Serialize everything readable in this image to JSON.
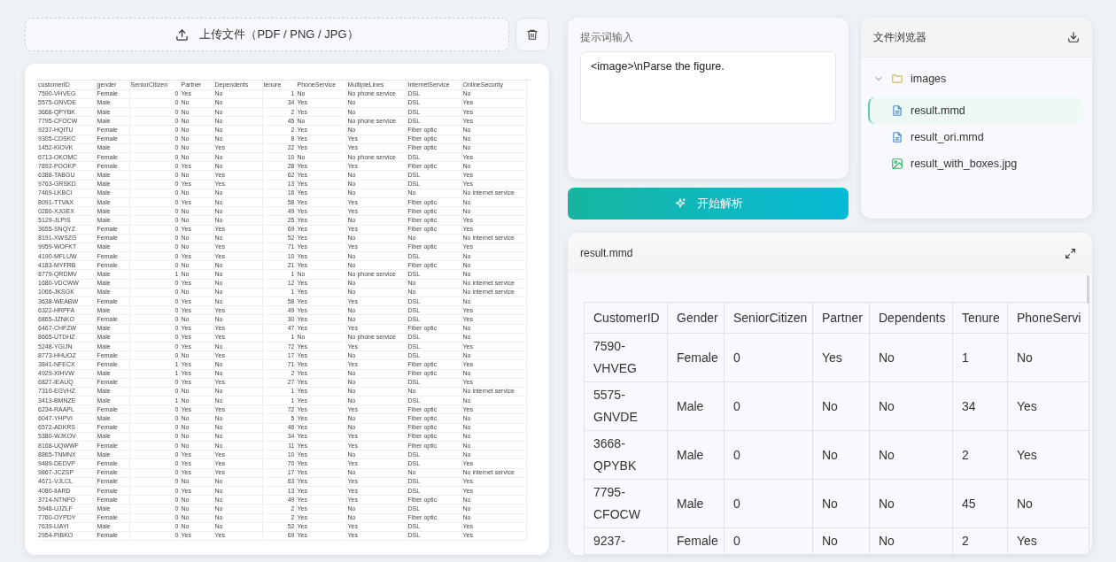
{
  "upload_button": {
    "label": "上传文件（PDF / PNG / JPG）"
  },
  "document_preview": {
    "columns": [
      "customerID",
      "gender",
      "SeniorCitizen",
      "Partner",
      "Dependents",
      "tenure",
      "PhoneService",
      "MultipleLines",
      "InternetService",
      "OnlineSecurity"
    ],
    "rows": [
      [
        "7590-VHVEG",
        "Female",
        "0",
        "Yes",
        "No",
        "1",
        "No",
        "No phone service",
        "DSL",
        "No"
      ],
      [
        "5575-GNVDE",
        "Male",
        "0",
        "No",
        "No",
        "34",
        "Yes",
        "No",
        "DSL",
        "Yes"
      ],
      [
        "3668-QPYBK",
        "Male",
        "0",
        "No",
        "No",
        "2",
        "Yes",
        "No",
        "DSL",
        "Yes"
      ],
      [
        "7795-CFOCW",
        "Male",
        "0",
        "No",
        "No",
        "45",
        "No",
        "No phone service",
        "DSL",
        "Yes"
      ],
      [
        "9237-HQITU",
        "Female",
        "0",
        "No",
        "No",
        "2",
        "Yes",
        "No",
        "Fiber optic",
        "No"
      ],
      [
        "9305-CDSKC",
        "Female",
        "0",
        "No",
        "No",
        "8",
        "Yes",
        "Yes",
        "Fiber optic",
        "No"
      ],
      [
        "1452-KIOVK",
        "Male",
        "0",
        "No",
        "Yes",
        "22",
        "Yes",
        "Yes",
        "Fiber optic",
        "No"
      ],
      [
        "6713-OKOMC",
        "Female",
        "0",
        "No",
        "No",
        "10",
        "No",
        "No phone service",
        "DSL",
        "Yes"
      ],
      [
        "7892-POOKP",
        "Female",
        "0",
        "Yes",
        "No",
        "28",
        "Yes",
        "Yes",
        "Fiber optic",
        "No"
      ],
      [
        "6388-TABGU",
        "Male",
        "0",
        "No",
        "Yes",
        "62",
        "Yes",
        "No",
        "DSL",
        "Yes"
      ],
      [
        "9763-GRSKD",
        "Male",
        "0",
        "Yes",
        "Yes",
        "13",
        "Yes",
        "No",
        "DSL",
        "Yes"
      ],
      [
        "7469-LKBCI",
        "Male",
        "0",
        "No",
        "No",
        "16",
        "Yes",
        "No",
        "No",
        "No internet service"
      ],
      [
        "8091-TTVAX",
        "Male",
        "0",
        "Yes",
        "No",
        "58",
        "Yes",
        "Yes",
        "Fiber optic",
        "No"
      ],
      [
        "0280-XJGEX",
        "Male",
        "0",
        "No",
        "No",
        "49",
        "Yes",
        "Yes",
        "Fiber optic",
        "No"
      ],
      [
        "5129-JLPIS",
        "Male",
        "0",
        "No",
        "No",
        "25",
        "Yes",
        "No",
        "Fiber optic",
        "Yes"
      ],
      [
        "3655-SNQYZ",
        "Female",
        "0",
        "Yes",
        "Yes",
        "69",
        "Yes",
        "Yes",
        "Fiber optic",
        "Yes"
      ],
      [
        "8191-XWSZG",
        "Female",
        "0",
        "No",
        "No",
        "52",
        "Yes",
        "No",
        "No",
        "No internet service"
      ],
      [
        "9959-WOFKT",
        "Male",
        "0",
        "No",
        "Yes",
        "71",
        "Yes",
        "Yes",
        "Fiber optic",
        "Yes"
      ],
      [
        "4190-MFLUW",
        "Female",
        "0",
        "Yes",
        "Yes",
        "10",
        "Yes",
        "No",
        "DSL",
        "No"
      ],
      [
        "4183-MYFRB",
        "Female",
        "0",
        "No",
        "No",
        "21",
        "Yes",
        "No",
        "Fiber optic",
        "No"
      ],
      [
        "8779-QRDMV",
        "Male",
        "1",
        "No",
        "No",
        "1",
        "No",
        "No phone service",
        "DSL",
        "No"
      ],
      [
        "1680-VDCWW",
        "Male",
        "0",
        "Yes",
        "No",
        "12",
        "Yes",
        "No",
        "No",
        "No internet service"
      ],
      [
        "1066-JKSGK",
        "Male",
        "0",
        "No",
        "No",
        "1",
        "Yes",
        "No",
        "No",
        "No internet service"
      ],
      [
        "3638-WEABW",
        "Female",
        "0",
        "Yes",
        "No",
        "58",
        "Yes",
        "Yes",
        "DSL",
        "No"
      ],
      [
        "6322-HRPFA",
        "Male",
        "0",
        "Yes",
        "Yes",
        "49",
        "Yes",
        "No",
        "DSL",
        "Yes"
      ],
      [
        "6865-JZNKO",
        "Female",
        "0",
        "No",
        "No",
        "30",
        "Yes",
        "No",
        "DSL",
        "Yes"
      ],
      [
        "6467-CHFZW",
        "Male",
        "0",
        "Yes",
        "Yes",
        "47",
        "Yes",
        "Yes",
        "Fiber optic",
        "No"
      ],
      [
        "8665-UTDHZ",
        "Male",
        "0",
        "Yes",
        "Yes",
        "1",
        "No",
        "No phone service",
        "DSL",
        "No"
      ],
      [
        "5248-YGIJN",
        "Male",
        "0",
        "Yes",
        "No",
        "72",
        "Yes",
        "Yes",
        "DSL",
        "Yes"
      ],
      [
        "8773-HHUOZ",
        "Female",
        "0",
        "No",
        "Yes",
        "17",
        "Yes",
        "No",
        "DSL",
        "No"
      ],
      [
        "3841-NFECX",
        "Female",
        "1",
        "Yes",
        "No",
        "71",
        "Yes",
        "Yes",
        "Fiber optic",
        "Yes"
      ],
      [
        "4929-XIHVW",
        "Male",
        "1",
        "Yes",
        "No",
        "2",
        "Yes",
        "No",
        "Fiber optic",
        "No"
      ],
      [
        "6827-IEAUQ",
        "Female",
        "0",
        "Yes",
        "Yes",
        "27",
        "Yes",
        "No",
        "DSL",
        "Yes"
      ],
      [
        "7310-EGVHZ",
        "Male",
        "0",
        "No",
        "No",
        "1",
        "Yes",
        "No",
        "No",
        "No internet service"
      ],
      [
        "3413-BMNZE",
        "Male",
        "1",
        "No",
        "No",
        "1",
        "Yes",
        "No",
        "DSL",
        "No"
      ],
      [
        "6234-RAAPL",
        "Female",
        "0",
        "Yes",
        "Yes",
        "72",
        "Yes",
        "Yes",
        "Fiber optic",
        "Yes"
      ],
      [
        "6047-YHPVI",
        "Male",
        "0",
        "No",
        "No",
        "5",
        "Yes",
        "No",
        "Fiber optic",
        "No"
      ],
      [
        "6572-ADKRS",
        "Female",
        "0",
        "No",
        "No",
        "46",
        "Yes",
        "No",
        "Fiber optic",
        "No"
      ],
      [
        "5380-WJKOV",
        "Male",
        "0",
        "No",
        "No",
        "34",
        "Yes",
        "Yes",
        "Fiber optic",
        "No"
      ],
      [
        "8168-UQWWF",
        "Female",
        "0",
        "No",
        "No",
        "11",
        "Yes",
        "Yes",
        "Fiber optic",
        "No"
      ],
      [
        "8865-TNMNX",
        "Male",
        "0",
        "Yes",
        "Yes",
        "10",
        "Yes",
        "No",
        "DSL",
        "No"
      ],
      [
        "9489-DEDVP",
        "Female",
        "0",
        "Yes",
        "Yes",
        "70",
        "Yes",
        "Yes",
        "DSL",
        "Yes"
      ],
      [
        "9867-JCZSP",
        "Female",
        "0",
        "Yes",
        "Yes",
        "17",
        "Yes",
        "No",
        "No",
        "No internet service"
      ],
      [
        "4671-VJLCL",
        "Female",
        "0",
        "No",
        "No",
        "63",
        "Yes",
        "Yes",
        "DSL",
        "Yes"
      ],
      [
        "4080-IIARD",
        "Female",
        "0",
        "Yes",
        "No",
        "13",
        "Yes",
        "Yes",
        "DSL",
        "Yes"
      ],
      [
        "3714-NTNFO",
        "Female",
        "0",
        "No",
        "No",
        "49",
        "Yes",
        "Yes",
        "Fiber optic",
        "No"
      ],
      [
        "5948-UJZLF",
        "Male",
        "0",
        "No",
        "No",
        "2",
        "Yes",
        "No",
        "DSL",
        "No"
      ],
      [
        "7760-OYPDY",
        "Female",
        "0",
        "No",
        "No",
        "2",
        "Yes",
        "No",
        "Fiber optic",
        "No"
      ],
      [
        "7639-LIAYI",
        "Male",
        "0",
        "No",
        "No",
        "52",
        "Yes",
        "Yes",
        "DSL",
        "Yes"
      ],
      [
        "2954-PIBKO",
        "Female",
        "0",
        "Yes",
        "Yes",
        "69",
        "Yes",
        "Yes",
        "DSL",
        "Yes"
      ]
    ]
  },
  "prompt": {
    "label": "提示词输入",
    "value": "<image>\\nParse the figure."
  },
  "parse_button": {
    "label": "开始解析"
  },
  "file_browser": {
    "title": "文件浏览器",
    "tree": [
      {
        "name": "images",
        "kind": "folder",
        "expanded": true,
        "selected": false,
        "children": [
          {
            "name": "result.mmd",
            "kind": "document",
            "selected": true
          },
          {
            "name": "result_ori.mmd",
            "kind": "document",
            "selected": false
          },
          {
            "name": "result_with_boxes.jpg",
            "kind": "image",
            "selected": false
          }
        ]
      }
    ]
  },
  "result": {
    "title": "result.mmd",
    "table": {
      "columns": [
        "CustomerID",
        "Gender",
        "SeniorCitizen",
        "Partner",
        "Dependents",
        "Tenure",
        "PhoneServi"
      ],
      "rows": [
        [
          "7590-VHVEG",
          "Female",
          "0",
          "Yes",
          "No",
          "1",
          "No"
        ],
        [
          "5575-GNVDE",
          "Male",
          "0",
          "No",
          "No",
          "34",
          "Yes"
        ],
        [
          "3668-QPYBK",
          "Male",
          "0",
          "No",
          "No",
          "2",
          "Yes"
        ],
        [
          "7795-CFOCW",
          "Male",
          "0",
          "No",
          "No",
          "45",
          "No"
        ],
        [
          "9237-",
          "Female",
          "0",
          "No",
          "No",
          "2",
          "Yes"
        ]
      ]
    }
  }
}
